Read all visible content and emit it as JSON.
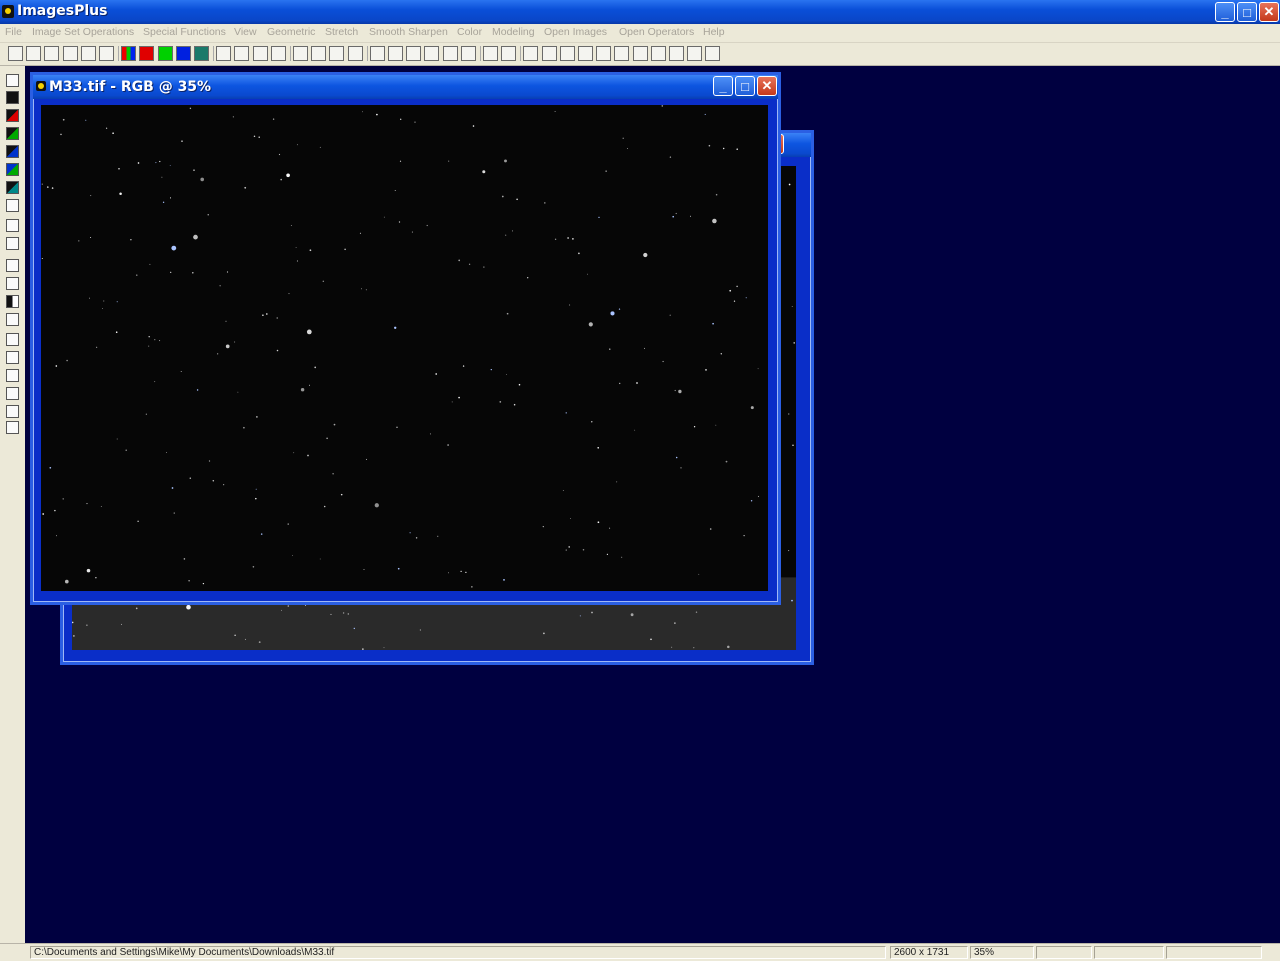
{
  "app": {
    "title": "ImagesPlus",
    "minimize_glyph": "_",
    "maximize_glyph": "□",
    "close_glyph": "✕"
  },
  "menu": [
    "File",
    "Image Set Operations",
    "Special Functions",
    "View",
    "Geometric",
    "Stretch",
    "Smooth Sharpen",
    "Color",
    "Modeling",
    "Open Images",
    "Open Operators",
    "Help"
  ],
  "toolbar_icons": [
    "new-icon",
    "open-icon",
    "save-icon",
    "close-icon",
    "close-all-icon",
    "print-icon",
    "rgb-icon",
    "red-channel-icon",
    "green-channel-icon",
    "blue-channel-icon",
    "luminance-icon",
    "undo-icon",
    "redo-icon",
    "undo-all-icon",
    "redo-all-icon",
    "circle-select-icon",
    "ellipse-select-icon",
    "line-profile-icon",
    "star-profile-icon",
    "histogram-icon",
    "curve-icon",
    "add-point-icon",
    "crosshair-icon",
    "grid-icon",
    "palette-icon",
    "pencil-icon",
    "map-icon",
    "zoom-in-icon",
    "zoom-out-icon",
    "zoom-fit-icon",
    "zoom-100-icon",
    "zoom-plus-icon",
    "zoom-minus-icon",
    "frame-icon",
    "frame-2-icon",
    "frame-3-icon",
    "frame-4-icon",
    "frame-5-icon"
  ],
  "left_tools": [
    "save-tool-icon",
    "black-tool-icon",
    "red-tool-icon",
    "green-tool-icon",
    "blue-tool-icon",
    "cyan-tool-icon",
    "teal-tool-icon",
    "corner-tool-icon",
    "dropper-tool-icon",
    "gradient-tool-icon",
    "marquee-tool-icon",
    "levels-tool-icon",
    "bw-tool-icon",
    "resize-tool-icon",
    "move-tool-icon",
    "up-arrow-tool-icon",
    "right-arrow-tool-icon",
    "rotate-left-tool-icon",
    "rotate-right-tool-icon",
    "flip-tool-icon"
  ],
  "front_window": {
    "title": "M33.tif - RGB @ 35%",
    "minimize_glyph": "_",
    "maximize_glyph": "□",
    "close_glyph": "✕"
  },
  "back_window": {
    "close_glyph": "✕"
  },
  "status": {
    "path": "C:\\Documents and Settings\\Mike\\My Documents\\Downloads\\M33.tif",
    "dimensions": "2600 x 1731",
    "zoom": "35%"
  },
  "colors": {
    "workspace": "#000040",
    "title_blue": "#0a4fd8",
    "close_red": "#c4391b"
  }
}
